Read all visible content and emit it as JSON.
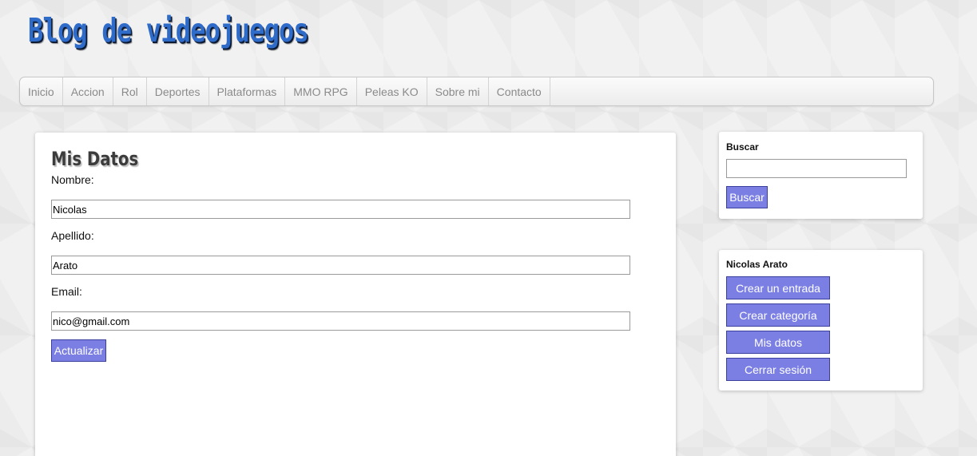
{
  "site": {
    "title": "Blog de videojuegos"
  },
  "nav": {
    "items": [
      "Inicio",
      "Accion",
      "Rol",
      "Deportes",
      "Plataformas",
      "MMO RPG",
      "Peleas KO",
      "Sobre mi",
      "Contacto"
    ]
  },
  "main": {
    "title": "Mis Datos",
    "fields": [
      {
        "label": "Nombre:",
        "value": "Nicolas"
      },
      {
        "label": "Apellido:",
        "value": "Arato"
      },
      {
        "label": "Email:",
        "value": "nico@gmail.com"
      }
    ],
    "submit_label": "Actualizar"
  },
  "sidebar": {
    "search": {
      "title": "Buscar",
      "value": "",
      "button_label": "Buscar"
    },
    "user": {
      "name": "Nicolas Arato",
      "buttons": [
        "Crear un entrada",
        "Crear categoría",
        "Mis datos",
        "Cerrar sesión"
      ]
    }
  },
  "colors": {
    "title_blue": "#2f6bc9",
    "button": "#7b7fe3",
    "button_border": "#3b3f9e"
  }
}
